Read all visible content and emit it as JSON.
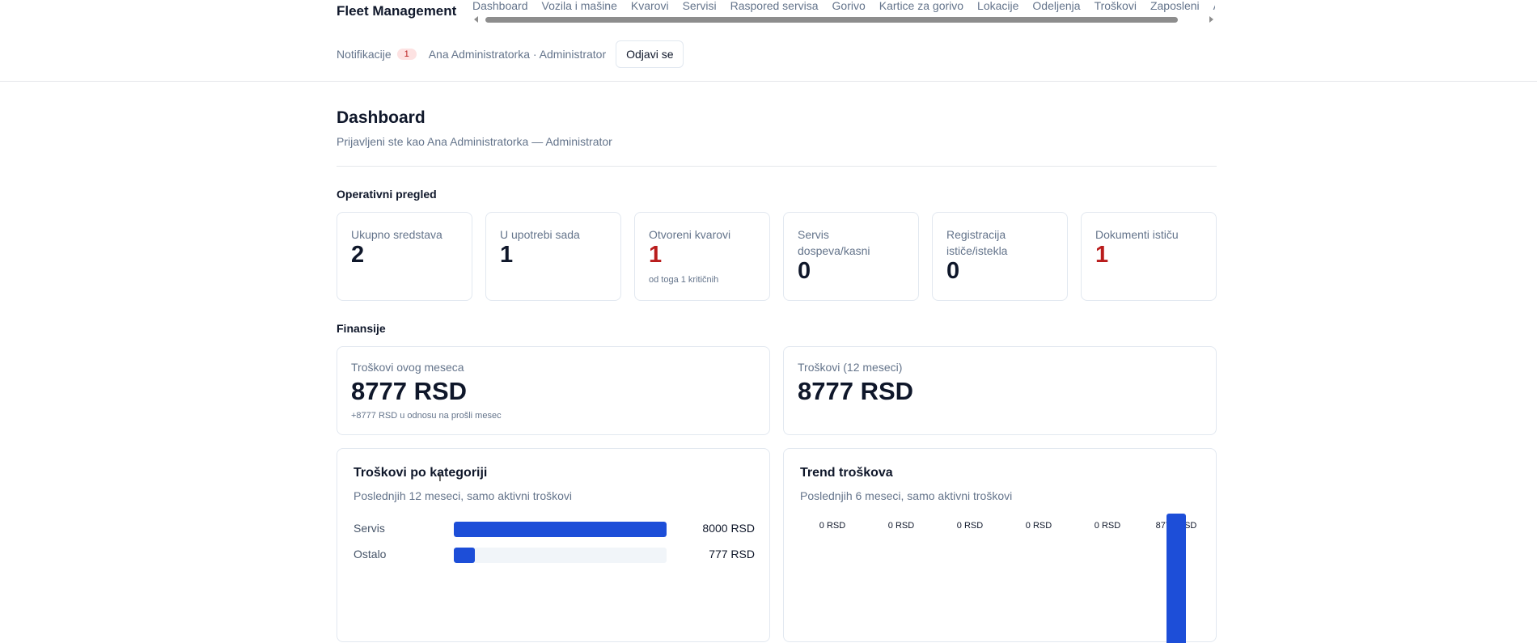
{
  "header": {
    "brand": "Fleet Management",
    "nav": [
      "Dashboard",
      "Vozila i mašine",
      "Kvarovi",
      "Servisi",
      "Raspored servisa",
      "Gorivo",
      "Kartice za gorivo",
      "Lokacije",
      "Odeljenja",
      "Troškovi",
      "Zaposleni",
      "A"
    ],
    "notifications_label": "Notifikacije",
    "notifications_count": "1",
    "user": "Ana Administratorka · Administrator",
    "logout_label": "Odjavi se"
  },
  "page": {
    "title": "Dashboard",
    "subtitle": "Prijavljeni ste kao Ana Administratorka — Administrator"
  },
  "operational": {
    "title": "Operativni pregled",
    "cards": [
      {
        "label": "Ukupno sredstava",
        "value": "2",
        "note": "",
        "alert": false
      },
      {
        "label": "U upotrebi sada",
        "value": "1",
        "note": "",
        "alert": false
      },
      {
        "label": "Otvoreni kvarovi",
        "value": "1",
        "note": "od toga 1 kritičnih",
        "alert": true
      },
      {
        "label": "Servis dospeva/kasni",
        "value": "0",
        "note": "",
        "alert": false
      },
      {
        "label": "Registracija ističe/istekla",
        "value": "0",
        "note": "",
        "alert": false
      },
      {
        "label": "Dokumenti ističu",
        "value": "1",
        "note": "",
        "alert": true
      }
    ]
  },
  "finance": {
    "title": "Finansije",
    "month": {
      "label": "Troškovi ovog meseca",
      "value": "8777 RSD",
      "note": "+8777 RSD u odnosu na prošli mesec"
    },
    "year": {
      "label": "Troškovi (12 meseci)",
      "value": "8777 RSD"
    }
  },
  "categories": {
    "title": "Troškovi po kategoriji",
    "subtitle": "Poslednjih 12 meseci, samo aktivni troškovi",
    "items": [
      {
        "name": "Servis",
        "value": 8000,
        "display": "8000 RSD"
      },
      {
        "name": "Ostalo",
        "value": 777,
        "display": "777 RSD"
      }
    ]
  },
  "trend": {
    "title": "Trend troškova",
    "subtitle": "Poslednjih 6 meseci, samo aktivni troškovi",
    "points": [
      {
        "label": "0 RSD",
        "value": 0
      },
      {
        "label": "0 RSD",
        "value": 0
      },
      {
        "label": "0 RSD",
        "value": 0
      },
      {
        "label": "0 RSD",
        "value": 0
      },
      {
        "label": "0 RSD",
        "value": 0
      },
      {
        "label": "8777 RSD",
        "value": 8777
      }
    ]
  },
  "colors": {
    "accent": "#1d4ed8",
    "alert": "#b91c1c",
    "muted": "#64748b"
  }
}
